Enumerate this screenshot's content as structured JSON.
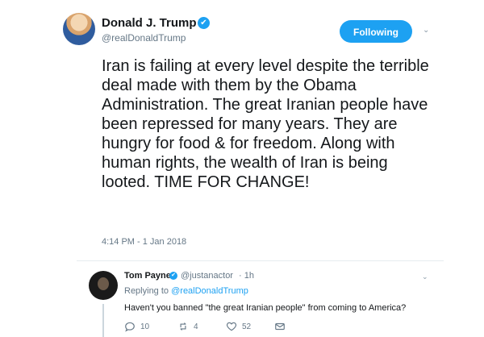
{
  "tweet": {
    "author_name": "Donald J. Trump",
    "author_handle": "@realDonaldTrump",
    "follow_label": "Following",
    "text": "Iran is failing at every level despite the terrible deal made with them by the Obama Administration. The great Iranian people have been repressed for many years. They are hungry for food & for freedom. Along with human rights, the wealth of Iran is being looted. TIME FOR CHANGE!",
    "timestamp": "4:14 PM - 1 Jan 2018"
  },
  "reply": {
    "author_name": "Tom Payne",
    "author_handle": "@justanactor",
    "time": "· 1h",
    "replying_prefix": "Replying to",
    "replying_to": "@realDonaldTrump",
    "text": "Haven't you banned \"the great Iranian people\" from coming to America?",
    "counts": {
      "replies": "10",
      "retweets": "4",
      "likes": "52"
    }
  },
  "icons": {
    "verified": "✔",
    "caret": "⌄"
  }
}
